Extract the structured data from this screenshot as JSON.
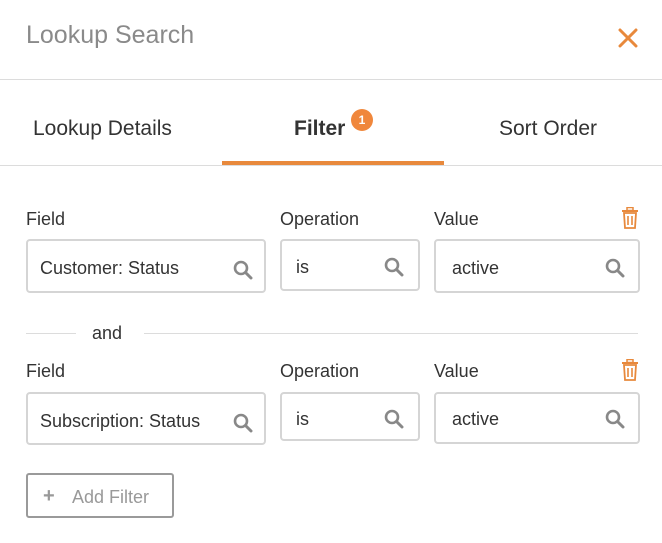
{
  "header": {
    "title": "Lookup Search"
  },
  "tabs": [
    {
      "label": "Lookup Details"
    },
    {
      "label": "Filter",
      "badge": "1"
    },
    {
      "label": "Sort Order"
    }
  ],
  "filters": [
    {
      "field_label": "Field",
      "field_value": "Customer: Status",
      "operation_label": "Operation",
      "operation_value": "is",
      "value_label": "Value",
      "value_value": "active"
    },
    {
      "field_label": "Field",
      "field_value": "Subscription: Status",
      "operation_label": "Operation",
      "operation_value": "is",
      "value_label": "Value",
      "value_value": "active"
    }
  ],
  "connector": "and",
  "add_filter": {
    "label": "Add Filter",
    "icon": "plus-icon"
  },
  "colors": {
    "accent": "#e8893c",
    "border": "#d5d5d5",
    "muted": "#999999"
  }
}
